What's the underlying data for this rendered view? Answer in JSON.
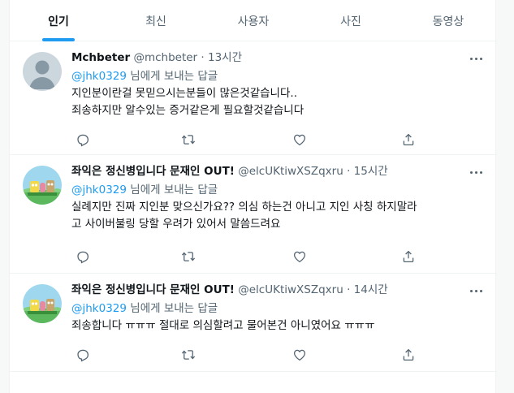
{
  "tabs": [
    {
      "label": "인기",
      "active": true
    },
    {
      "label": "최신",
      "active": false
    },
    {
      "label": "사용자",
      "active": false
    },
    {
      "label": "사진",
      "active": false
    },
    {
      "label": "동영상",
      "active": false
    }
  ],
  "colors": {
    "accent": "#1d9bf0",
    "secondary_text": "#536471",
    "divider": "#eff3f4"
  },
  "tweets": [
    {
      "name": "Mchbeter",
      "handle": "@mchbeter",
      "time": "13시간",
      "reply_mention": "@jhk0329",
      "reply_suffix": " 님에게 보내는 답글",
      "lines": [
        "지인분이란걸 못믿으시는분들이 많은것같습니다..",
        "죄송하지만 알수있는 증거같은게 필요할것같습니다"
      ],
      "avatar": "default-avatar"
    },
    {
      "name": "좌익은 정신병입니다 문재인 OUT!",
      "handle": "@elcUKtiwXSZqxru",
      "time": "15시간",
      "reply_mention": "@jhk0329",
      "reply_suffix": " 님에게 보내는 답글",
      "lines": [
        "실례지만 진짜 지인분 맞으신가요?? 의심 하는건 아니고 지인 사칭 하지말라",
        "고 사이버불링 당할 우려가 있어서 말씀드려요"
      ],
      "avatar": "cartoon-avatar"
    },
    {
      "name": "좌익은 정신병입니다 문재인 OUT!",
      "handle": "@elcUKtiwXSZqxru",
      "time": "14시간",
      "reply_mention": "@jhk0329",
      "reply_suffix": " 님에게 보내는 답글",
      "lines": [
        "죄송합니다 ㅠㅠㅠ 절대로 의심할려고 물어본건 아니였어요 ㅠㅠㅠ"
      ],
      "avatar": "cartoon-avatar"
    }
  ],
  "icons": {
    "reply": "reply-icon",
    "retweet": "retweet-icon",
    "like": "like-icon",
    "share": "share-icon",
    "more": "more-icon"
  },
  "separator": "·"
}
